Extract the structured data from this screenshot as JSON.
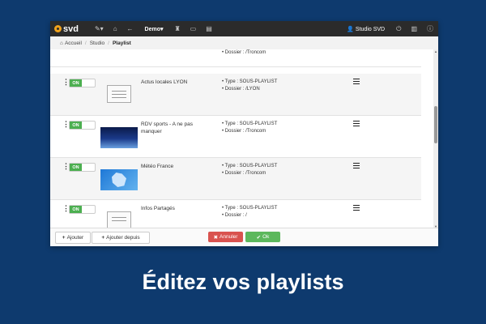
{
  "topbar": {
    "logo": "svd",
    "menu": "Demo",
    "user": "Studio SVD"
  },
  "breadcrumb": {
    "items": [
      "Accueil",
      "Studio",
      "Playlist"
    ]
  },
  "rows": [
    {
      "title": "",
      "type": "",
      "folder": "Dossier : /Troncom",
      "toggle": "ON"
    },
    {
      "title": "Actus locales LYON",
      "type": "Type : SOUS-PLAYLIST",
      "folder": "Dossier : /LYON",
      "toggle": "ON"
    },
    {
      "title": "RDV sports - A ne pas manquer",
      "type": "Type : SOUS-PLAYLIST",
      "folder": "Dossier : /Troncom",
      "toggle": "ON"
    },
    {
      "title": "Météo France",
      "type": "Type : SOUS-PLAYLIST",
      "folder": "Dossier : /Troncom",
      "toggle": "ON"
    },
    {
      "title": "Infos Partagés",
      "type": "Type : SOUS-PLAYLIST",
      "folder": "Dossier : /",
      "toggle": "ON"
    }
  ],
  "footer": {
    "add": "Ajouter",
    "add_from": "Ajouter depuis",
    "cancel": "Annuler",
    "ok": "Ok"
  },
  "caption": "Éditez vos playlists"
}
